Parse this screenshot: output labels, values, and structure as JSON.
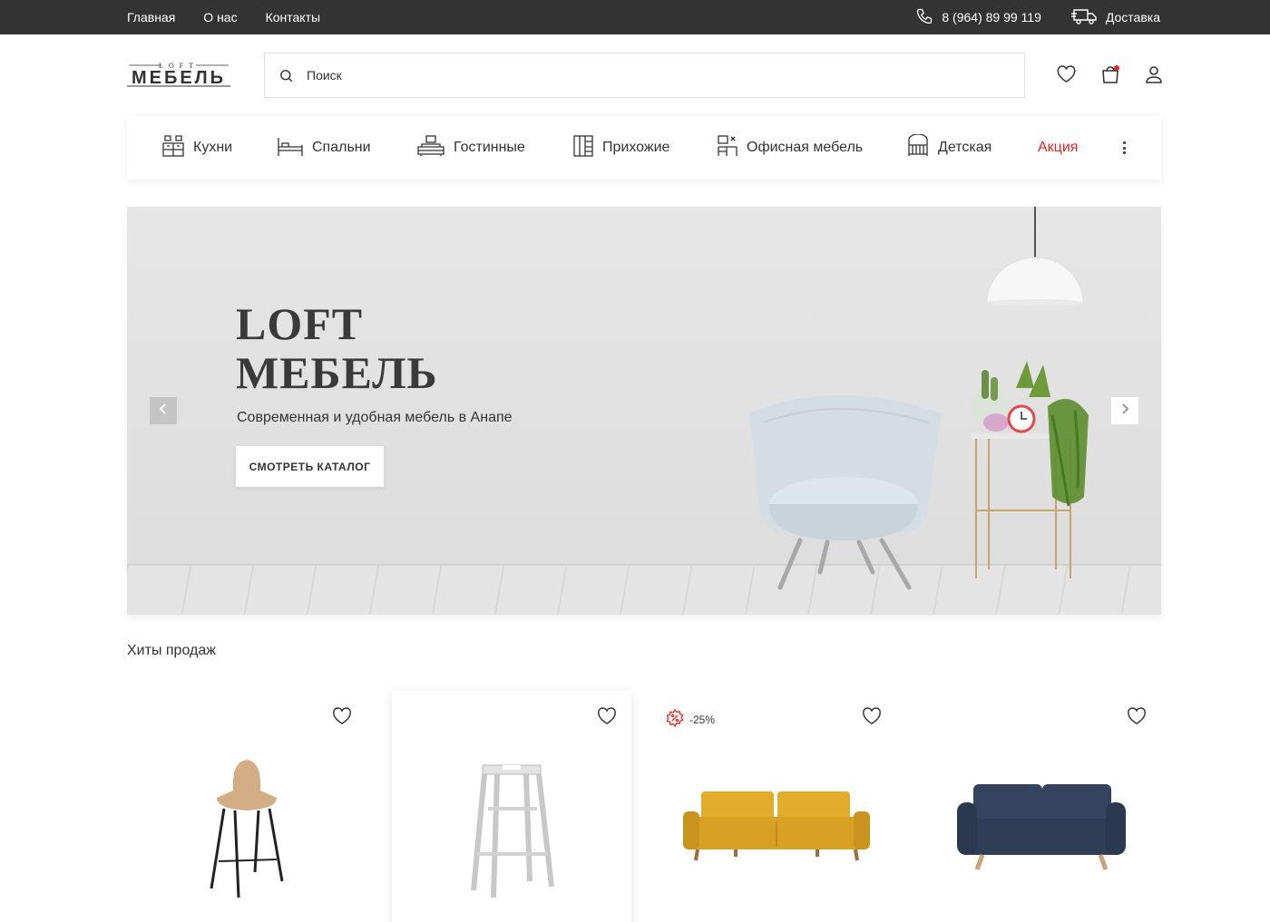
{
  "topbar": {
    "links": [
      "Главная",
      "О нас",
      "Контакты"
    ],
    "phone": "8 (964) 89 99 119",
    "delivery": "Доставка"
  },
  "logo": {
    "top_text": "LOFT",
    "main_text": "МЕБЕЛЬ"
  },
  "search": {
    "placeholder": "Поиск"
  },
  "categories": [
    {
      "label": "Кухни",
      "icon": "kitchen-icon"
    },
    {
      "label": "Спальни",
      "icon": "bed-icon"
    },
    {
      "label": "Гостинные",
      "icon": "living-room-icon"
    },
    {
      "label": "Прихожие",
      "icon": "wardrobe-icon"
    },
    {
      "label": "Офисная мебель",
      "icon": "office-desk-icon"
    },
    {
      "label": "Детская",
      "icon": "crib-icon"
    },
    {
      "label": "Акция",
      "icon": ""
    }
  ],
  "hero": {
    "title_line1": "LOFT",
    "title_line2": "МЕБЕЛЬ",
    "subtitle": "Современная и удобная мебель в Анапе",
    "button": "СМОТРЕТЬ КАТАЛОГ"
  },
  "bestsellers": {
    "title": "Хиты продаж",
    "products": [
      {
        "image": "bar-stool-beige",
        "badge": ""
      },
      {
        "image": "bar-stool-metal",
        "badge": ""
      },
      {
        "image": "sofa-yellow",
        "badge": "-25%"
      },
      {
        "image": "sofa-navy",
        "badge": ""
      }
    ]
  },
  "colors": {
    "topbar": "#333333",
    "accent_red": "#e32626",
    "text": "#333333"
  }
}
